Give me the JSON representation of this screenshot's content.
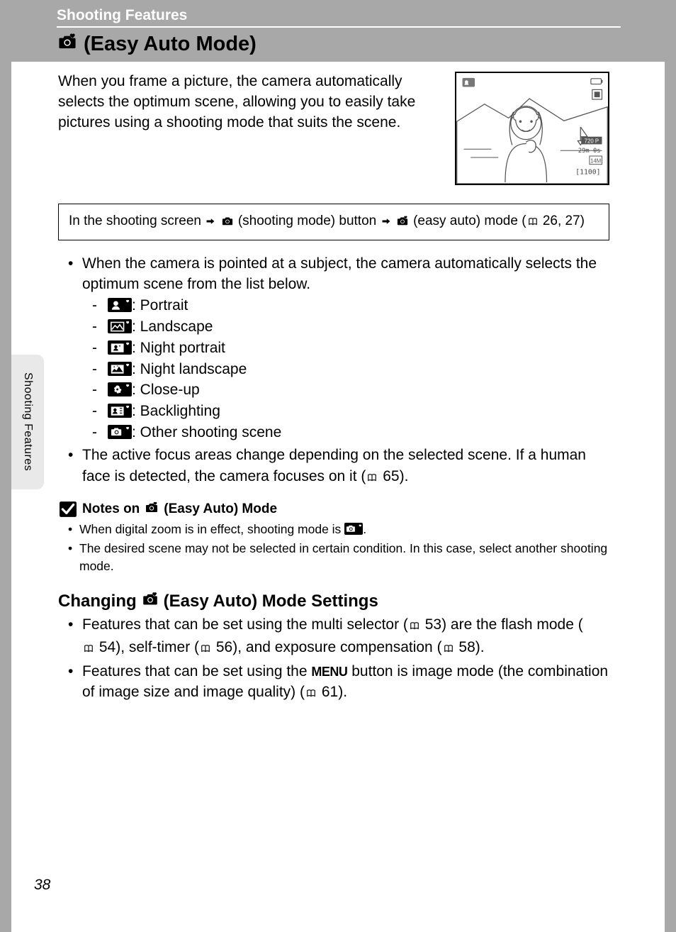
{
  "header": {
    "section": "Shooting Features",
    "title": "(Easy Auto Mode)"
  },
  "intro": "When you frame a picture, the camera automatically selects the optimum scene, allowing you to easily take pictures using a shooting mode that suits the scene.",
  "preview": {
    "video_label": "720 P",
    "time": "29m 0s",
    "size": "14M",
    "count": "[1100]"
  },
  "nav": {
    "prefix": "In the shooting screen",
    "step2": "(shooting mode) button",
    "step3": "(easy auto) mode (",
    "ref1": "26",
    "ref2": "27)"
  },
  "bullets": {
    "b1": "When the camera is pointed at a subject, the camera automatically selects the optimum scene from the list below.",
    "scenes": {
      "portrait": ": Portrait",
      "landscape": ": Landscape",
      "night_portrait": ": Night portrait",
      "night_landscape": ": Night landscape",
      "closeup": ": Close-up",
      "backlighting": ": Backlighting",
      "other": ": Other shooting scene"
    },
    "b2a": "The active focus areas change depending on the selected scene. If a human face is detected, the camera focuses on it (",
    "b2ref": "65",
    "b2b": ")."
  },
  "notes": {
    "title_prefix": "Notes on",
    "title_suffix": "(Easy Auto) Mode",
    "n1a": "When digital zoom is in effect, shooting mode is ",
    "n1b": ".",
    "n2": "The desired scene may not be selected in certain condition. In this case, select another shooting mode."
  },
  "changing": {
    "title_prefix": "Changing",
    "title_suffix": "(Easy Auto) Mode Settings",
    "c1a": "Features that can be set using the multi selector (",
    "c1ref1": "53",
    "c1b": ") are the flash mode (",
    "c1ref2": "54",
    "c1c": "), self-timer (",
    "c1ref3": "56",
    "c1d": "), and exposure compensation (",
    "c1ref4": "58",
    "c1e": ").",
    "c2a": "Features that can be set using the ",
    "c2menu": "MENU",
    "c2b": " button is image mode (the combination of image size and image quality) (",
    "c2ref": "61",
    "c2c": ")."
  },
  "sidetab": "Shooting Features",
  "page_number": "38"
}
